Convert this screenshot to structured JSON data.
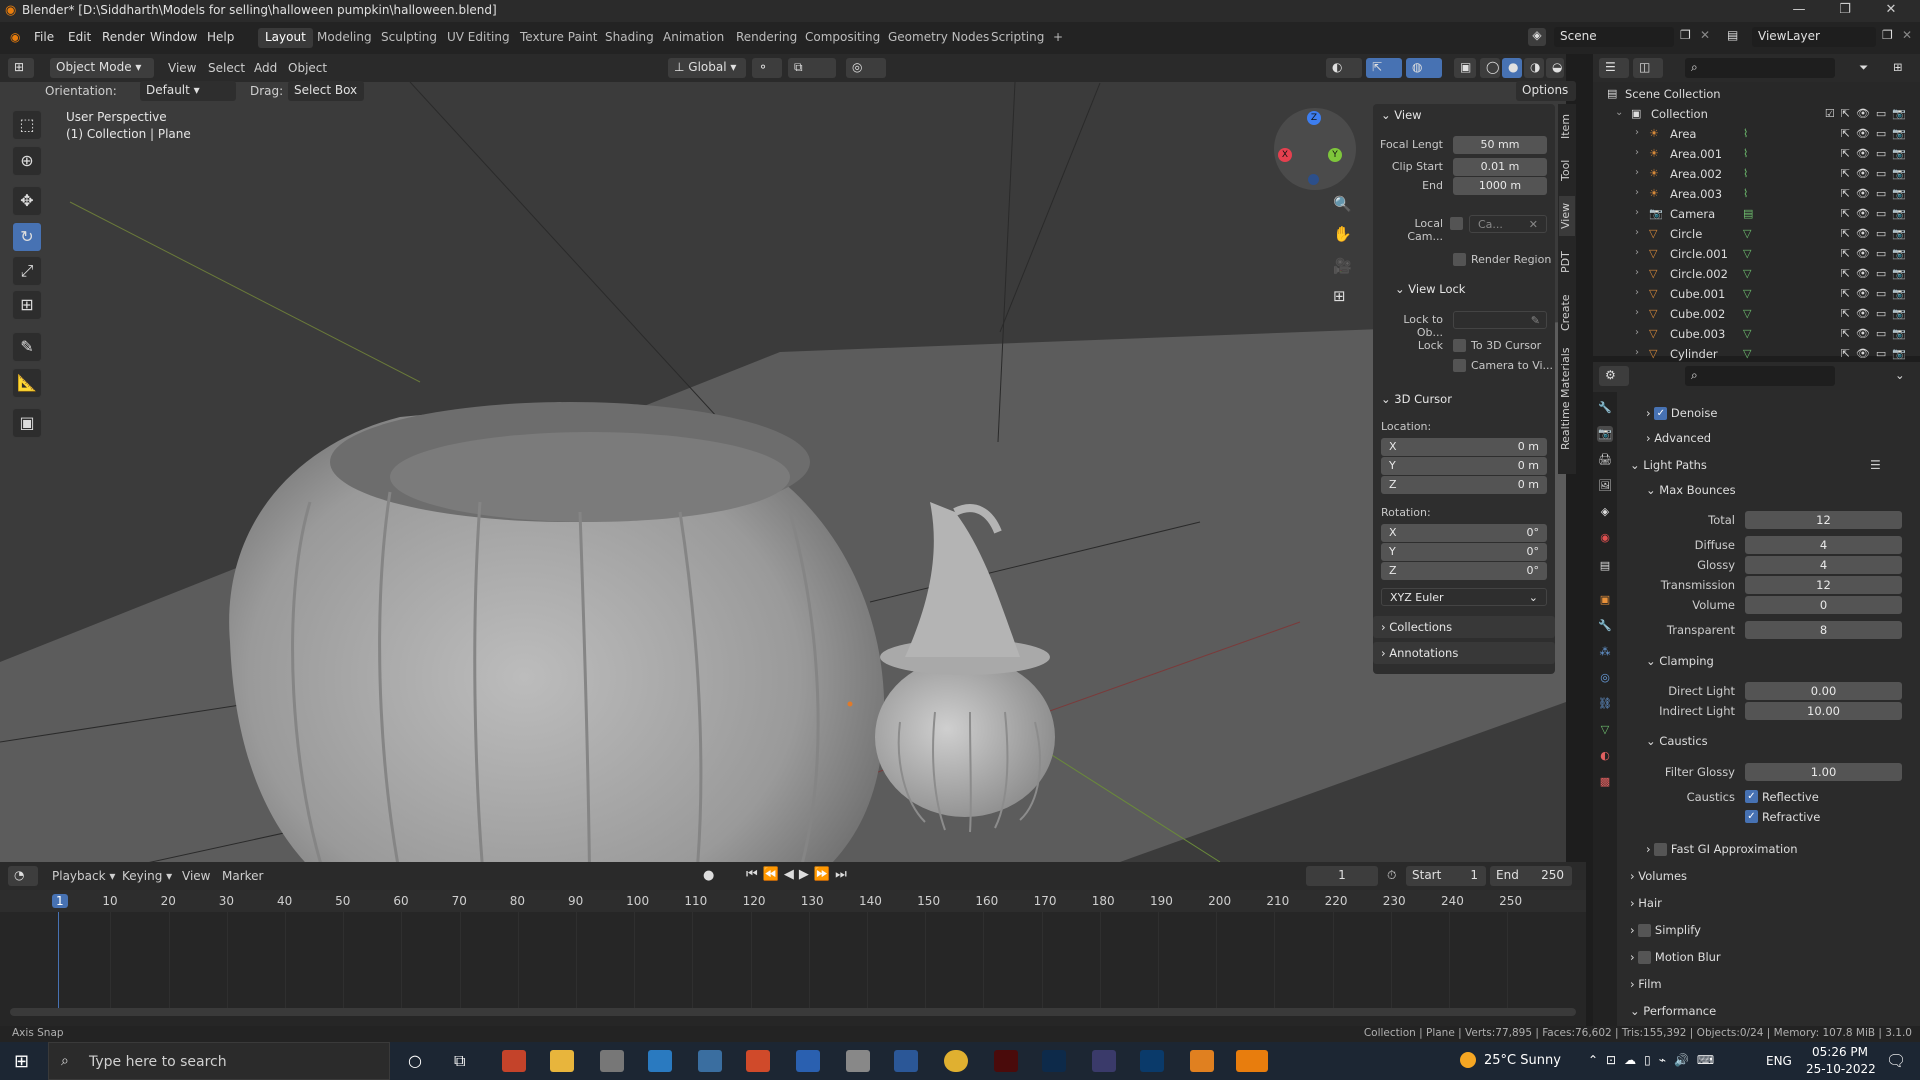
{
  "window": {
    "title": "Blender* [D:\\Siddharth\\Models for selling\\halloween pumpkin\\halloween.blend]"
  },
  "menu": [
    "File",
    "Edit",
    "Render",
    "Window",
    "Help"
  ],
  "workspaces": [
    "Layout",
    "Modeling",
    "Sculpting",
    "UV Editing",
    "Texture Paint",
    "Shading",
    "Animation",
    "Rendering",
    "Compositing",
    "Geometry Nodes",
    "Scripting",
    "+"
  ],
  "active_workspace": "Layout",
  "scene": {
    "label": "Scene",
    "view_layer": "ViewLayer"
  },
  "viewport_header": {
    "mode": "Object Mode",
    "menus": [
      "View",
      "Select",
      "Add",
      "Object"
    ],
    "transform": "Global",
    "options": "Options",
    "orientation_label": "Orientation:",
    "orientation_value": "Default",
    "drag_label": "Drag:",
    "drag_value": "Select Box"
  },
  "viewport": {
    "perspective": "User Perspective",
    "collection_info": "(1) Collection | Plane"
  },
  "gizmo": {
    "x": "X",
    "y": "Y",
    "z": "Z"
  },
  "npanel": {
    "view_header": "View",
    "focal_label": "Focal Lengt",
    "focal_value": "50 mm",
    "clip_start_label": "Clip Start",
    "clip_start_value": "0.01 m",
    "end_label": "End",
    "end_value": "1000 m",
    "local_cam_label": "Local Cam...",
    "local_cam_value": "Ca...",
    "render_region": "Render Region",
    "view_lock_header": "View Lock",
    "lock_to_obj_label": "Lock to Ob...",
    "lock_label": "Lock",
    "to_3d_cursor": "To 3D Cursor",
    "camera_to_view": "Camera to Vi...",
    "cursor_header": "3D Cursor",
    "location_label": "Location:",
    "loc_x": "0 m",
    "loc_y": "0 m",
    "loc_z": "0 m",
    "rotation_label": "Rotation:",
    "rot_x": "0°",
    "rot_y": "0°",
    "rot_z": "0°",
    "axis_x": "X",
    "axis_y": "Y",
    "axis_z": "Z",
    "rot_mode": "XYZ Euler",
    "collections": "Collections",
    "annotations": "Annotations"
  },
  "side_tabs": [
    "Item",
    "Tool",
    "View",
    "PDT",
    "Create",
    "Realtime Materials"
  ],
  "outliner": {
    "root": "Scene Collection",
    "collection": "Collection",
    "items": [
      {
        "name": "Area",
        "type": "light"
      },
      {
        "name": "Area.001",
        "type": "light"
      },
      {
        "name": "Area.002",
        "type": "light"
      },
      {
        "name": "Area.003",
        "type": "light"
      },
      {
        "name": "Camera",
        "type": "camera"
      },
      {
        "name": "Circle",
        "type": "mesh"
      },
      {
        "name": "Circle.001",
        "type": "mesh"
      },
      {
        "name": "Circle.002",
        "type": "mesh"
      },
      {
        "name": "Cube.001",
        "type": "mesh"
      },
      {
        "name": "Cube.002",
        "type": "mesh"
      },
      {
        "name": "Cube.003",
        "type": "mesh"
      },
      {
        "name": "Cylinder",
        "type": "mesh"
      }
    ]
  },
  "properties": {
    "denoise": "Denoise",
    "advanced": "Advanced",
    "light_paths": "Light Paths",
    "max_bounces": "Max Bounces",
    "total_label": "Total",
    "total": "12",
    "diffuse_label": "Diffuse",
    "diffuse": "4",
    "glossy_label": "Glossy",
    "glossy": "4",
    "transmission_label": "Transmission",
    "transmission": "12",
    "volume_label": "Volume",
    "volume": "0",
    "transparent_label": "Transparent",
    "transparent": "8",
    "clamping": "Clamping",
    "direct_label": "Direct Light",
    "direct": "0.00",
    "indirect_label": "Indirect Light",
    "indirect": "10.00",
    "caustics": "Caustics",
    "filter_glossy_label": "Filter Glossy",
    "filter_glossy": "1.00",
    "caustics_label": "Caustics",
    "reflective": "Reflective",
    "refractive": "Refractive",
    "fast_gi": "Fast GI Approximation",
    "volumes": "Volumes",
    "hair": "Hair",
    "simplify": "Simplify",
    "motion_blur": "Motion Blur",
    "film": "Film",
    "performance": "Performance"
  },
  "timeline": {
    "menus": [
      "Playback",
      "Keying",
      "View",
      "Marker"
    ],
    "current_frame": "1",
    "start_label": "Start",
    "start": "1",
    "end_label": "End",
    "end": "250",
    "ticks": [
      "1",
      "10",
      "20",
      "30",
      "40",
      "50",
      "60",
      "70",
      "80",
      "90",
      "100",
      "110",
      "120",
      "130",
      "140",
      "150",
      "160",
      "170",
      "180",
      "190",
      "200",
      "210",
      "220",
      "230",
      "240",
      "250"
    ]
  },
  "statusbar": {
    "left": "Axis Snap",
    "right": "Collection | Plane | Verts:77,895 | Faces:76,602 | Tris:155,392 | Objects:0/24 | Memory: 107.8 MiB | 3.1.0"
  },
  "taskbar": {
    "search_placeholder": "Type here to search",
    "weather": "25°C  Sunny",
    "lang": "ENG",
    "time": "05:26 PM",
    "date": "25-10-2022"
  },
  "colors": {
    "accent": "#4772b3",
    "mesh": "#a7a7a7",
    "light_icon": "#d6893a",
    "mesh_icon": "#6fbf6f"
  }
}
